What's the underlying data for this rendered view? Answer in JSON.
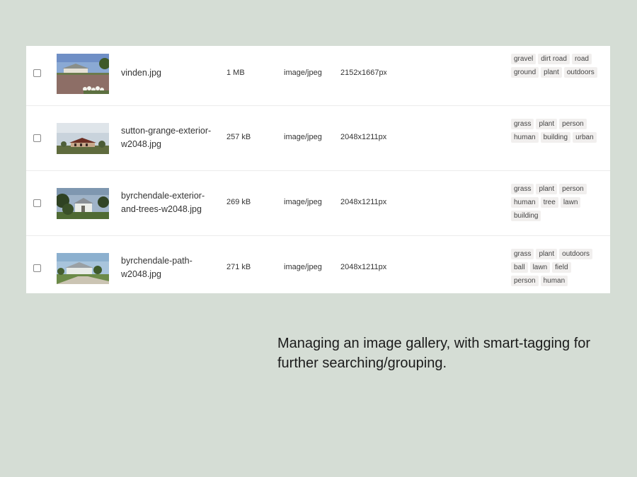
{
  "gallery": {
    "rows": [
      {
        "filename": "vinden.jpg",
        "size": "1 MB",
        "type": "image/jpeg",
        "dimensions": "2152x1667px",
        "tags": [
          "gravel",
          "dirt road",
          "road",
          "ground",
          "plant",
          "outdoors"
        ]
      },
      {
        "filename": "sutton-grange-exterior-w2048.jpg",
        "size": "257 kB",
        "type": "image/jpeg",
        "dimensions": "2048x1211px",
        "tags": [
          "grass",
          "plant",
          "person",
          "human",
          "building",
          "urban"
        ]
      },
      {
        "filename": "byrchendale-exterior-and-trees-w2048.jpg",
        "size": "269 kB",
        "type": "image/jpeg",
        "dimensions": "2048x1211px",
        "tags": [
          "grass",
          "plant",
          "person",
          "human",
          "tree",
          "lawn",
          "building"
        ]
      },
      {
        "filename": "byrchendale-path-w2048.jpg",
        "size": "271 kB",
        "type": "image/jpeg",
        "dimensions": "2048x1211px",
        "tags": [
          "grass",
          "plant",
          "outdoors",
          "ball",
          "lawn",
          "field",
          "person",
          "human"
        ]
      }
    ]
  },
  "caption": "Managing an image gallery, with smart-tagging for further searching/grouping."
}
